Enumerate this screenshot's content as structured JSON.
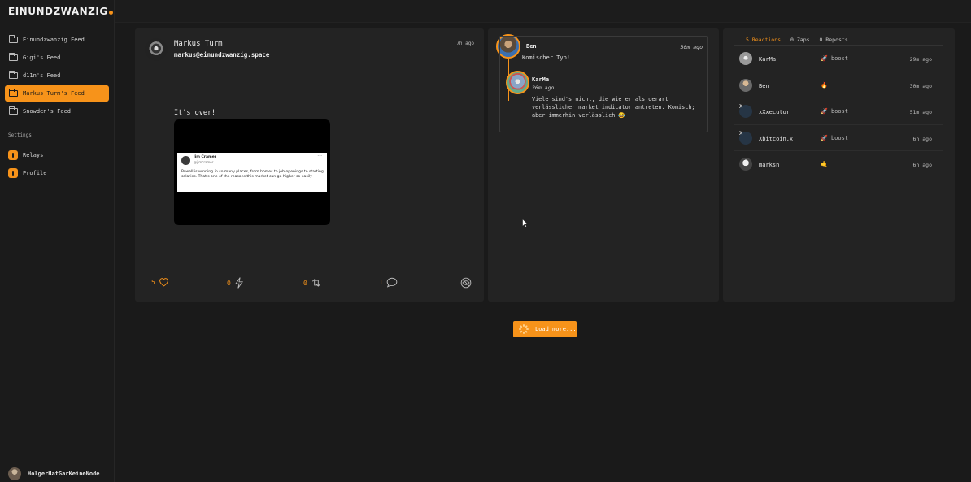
{
  "brand": {
    "logo_text": "EINUNDZWANZIG"
  },
  "sidebar": {
    "feeds": [
      {
        "label": "Einundzwanzig Feed",
        "active": false
      },
      {
        "label": "Gigi's Feed",
        "active": false
      },
      {
        "label": "d11n's Feed",
        "active": false
      },
      {
        "label": "Markus Turm's Feed",
        "active": true
      },
      {
        "label": "Snowden's Feed",
        "active": false
      }
    ],
    "settings_title": "Settings",
    "settings": [
      {
        "label": "Relays"
      },
      {
        "label": "Profile"
      }
    ],
    "current_user": "HolgerHatGarKeineNode"
  },
  "post": {
    "author_name": "Markus Turm",
    "author_nip05": "markus@einundzwanzig.space",
    "time": "7h ago",
    "text": "It's over!",
    "embedded_tweet": {
      "name": "Jim Cramer",
      "handle": "@jimcramer",
      "more": "···",
      "body": "Powell is winning in so many places, from homes to job openings to starting salaries. That's one of the reasons this market can go higher so easily"
    },
    "actions": {
      "likes": "5",
      "zaps": "0",
      "reposts": "0",
      "replies": "1"
    }
  },
  "thread": {
    "reply1": {
      "name": "Ben",
      "time": "30m ago",
      "text": "Komischer Typ!"
    },
    "reply2": {
      "name": "KarMa",
      "time": "26m ago",
      "text": "Viele sind's nicht, die wie er als derart verlässlicher market indicator antreten. Komisch; aber immerhin verlässlich 😂"
    }
  },
  "reactions_panel": {
    "tabs": [
      "5 Reactions",
      "0 Zaps",
      "0 Reposts"
    ],
    "active_tab": 0,
    "rows": [
      {
        "name": "KarMa",
        "emoji": "🚀",
        "reaction": "boost",
        "time": "29m ago",
        "avatar": "karma"
      },
      {
        "name": "Ben",
        "emoji": "🔥",
        "reaction": "",
        "time": "30m ago",
        "avatar": "ben"
      },
      {
        "name": "xXxecutor",
        "emoji": "🚀",
        "reaction": "boost",
        "time": "51m ago",
        "avatar": "x"
      },
      {
        "name": "Xbitcoin.x",
        "emoji": "🚀",
        "reaction": "boost",
        "time": "6h ago",
        "avatar": "x"
      },
      {
        "name": "marksn",
        "emoji": "🤙",
        "reaction": "",
        "time": "6h ago",
        "avatar": "marksn"
      }
    ],
    "avatar_x_label": "X"
  },
  "load_more": {
    "label": "Load more..."
  },
  "colors": {
    "accent": "#f7931a",
    "background": "#1a1a1a",
    "panel": "#232323"
  }
}
